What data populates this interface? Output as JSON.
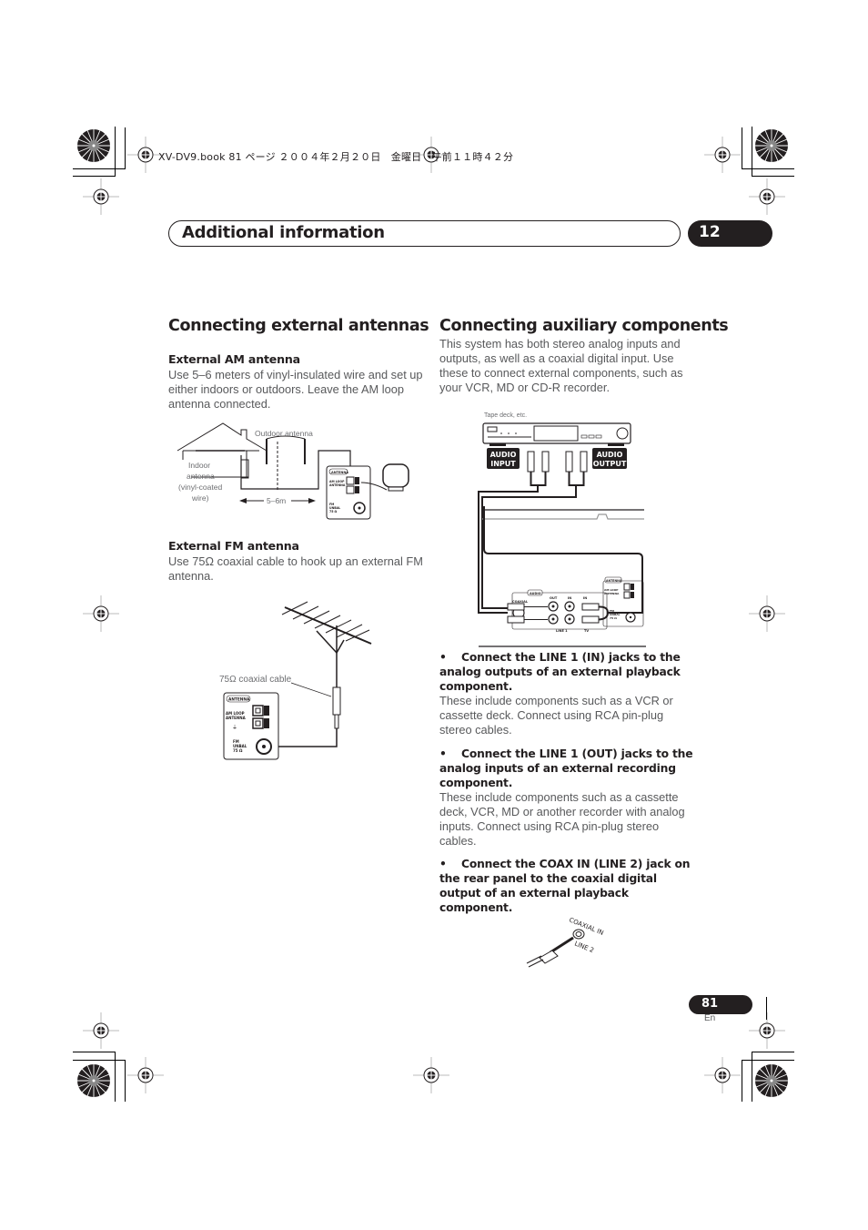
{
  "print_header": {
    "text": "XV-DV9.book  81 ページ  ２００４年２月２０日　金曜日　午前１１時４２分"
  },
  "chapter": {
    "title": "Additional information",
    "number": "12"
  },
  "left_column": {
    "heading": "Connecting external antennas",
    "am": {
      "subheading": "External AM antenna",
      "body": "Use 5–6 meters of vinyl-insulated wire and set up either indoors or outdoors. Leave the AM loop antenna connected.",
      "diagram": {
        "outdoor_label": "Outdoor antenna",
        "indoor_label_lines": [
          "Indoor",
          "antenna",
          "(vinyl-coated",
          "wire)"
        ],
        "distance_label": "5–6m",
        "panel_title": "ANTENNA",
        "am_loop_label_lines": [
          "AM LOOP",
          "ANTENNA"
        ],
        "fm_label_lines": [
          "FM",
          "UNBAL",
          "75 Ω"
        ]
      }
    },
    "fm": {
      "subheading": "External FM antenna",
      "body": "Use 75Ω coaxial cable to hook up an external FM antenna.",
      "diagram": {
        "cable_label": "75Ω coaxial cable",
        "panel_title": "ANTENNA",
        "am_loop_label_lines": [
          "AM LOOP",
          "ANTENNA"
        ],
        "fm_label_lines": [
          "FM",
          "UNBAL",
          "75 Ω"
        ]
      }
    }
  },
  "right_column": {
    "heading": "Connecting auxiliary components",
    "intro": "This system has both stereo analog inputs and outputs, as well as a coaxial digital input. Use these to connect external components, such as your VCR, MD or CD-R recorder.",
    "diagram": {
      "device_label": "Tape deck, etc.",
      "audio_input_lines": [
        "AUDIO",
        "INPUT"
      ],
      "audio_output_lines": [
        "AUDIO",
        "OUTPUT"
      ],
      "panel_audio": "AUDIO",
      "panel_out": "OUT",
      "panel_in": "IN",
      "panel_in2": "IN",
      "panel_coax": "COAXIAL",
      "panel_line1": "LINE 1",
      "panel_tv": "TV",
      "panel_antenna": "ANTENNA",
      "panel_am_loop_lines": [
        "AM LOOP",
        "ANTENNA"
      ],
      "panel_fm_lines": [
        "FM",
        "UNBAL",
        "75 Ω"
      ]
    },
    "bullets": [
      {
        "head": "Connect the LINE 1 (IN) jacks to the analog outputs of an external playback component.",
        "body": "These include components such as a VCR or cassette deck. Connect using RCA pin-plug stereo cables."
      },
      {
        "head": "Connect the LINE 1 (OUT) jacks to the analog inputs of an external recording component.",
        "body": "These include components such as a cassette deck, VCR, MD or another recorder with analog inputs. Connect using RCA pin-plug stereo cables."
      },
      {
        "head": "Connect the COAX IN (LINE 2) jack on the rear panel to the coaxial digital output of an external playback component.",
        "body": ""
      }
    ],
    "coax_diagram": {
      "label_top": "COAXIAL IN",
      "label_bottom": "LINE 2"
    }
  },
  "footer": {
    "page_number": "81",
    "language": "En"
  }
}
